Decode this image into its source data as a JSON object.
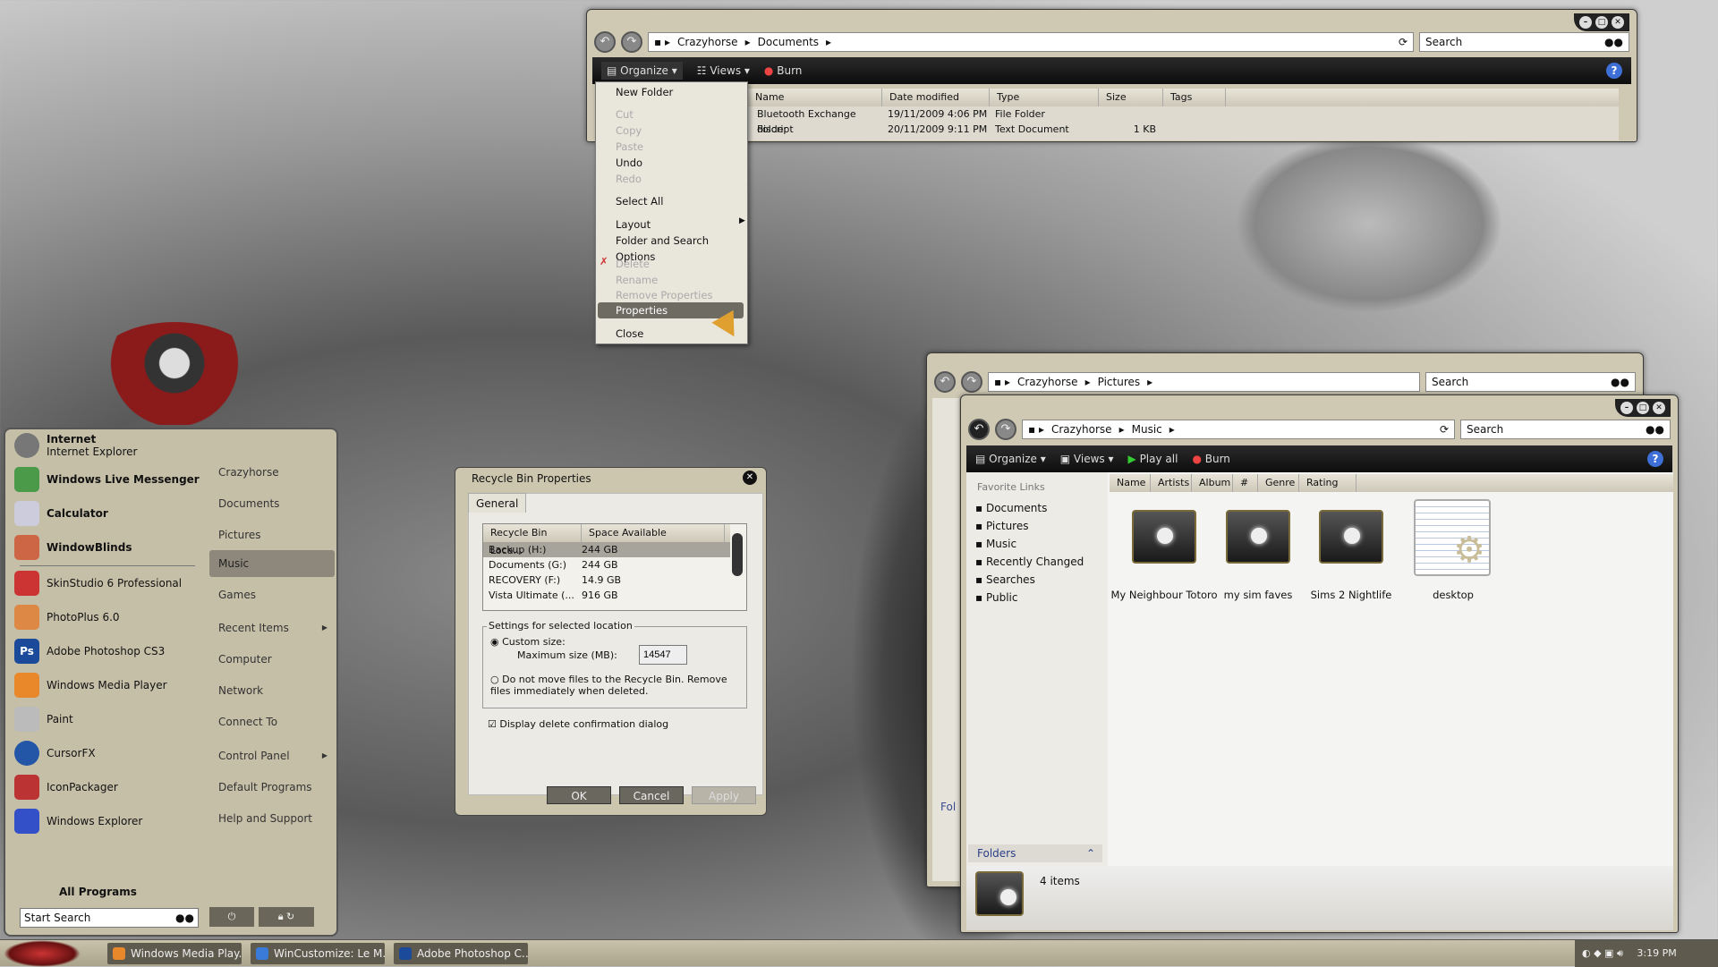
{
  "documents_window": {
    "breadcrumb": [
      "Crazyhorse",
      "Documents"
    ],
    "search_placeholder": "Search",
    "toolbar": {
      "organize": "Organize",
      "views": "Views",
      "burn": "Burn"
    },
    "columns": [
      "Name",
      "Date modified",
      "Type",
      "Size",
      "Tags"
    ],
    "rows": [
      {
        "name": "Bluetooth Exchange Folder",
        "date": "19/11/2009 4:06 PM",
        "type": "File Folder",
        "size": ""
      },
      {
        "name": "discript",
        "date": "20/11/2009 9:11 PM",
        "type": "Text Document",
        "size": "1 KB"
      }
    ]
  },
  "organize_menu": {
    "items": [
      {
        "label": "New Folder",
        "disabled": false
      },
      {
        "label": "Cut",
        "disabled": true
      },
      {
        "label": "Copy",
        "disabled": true
      },
      {
        "label": "Paste",
        "disabled": true
      },
      {
        "label": "Undo",
        "disabled": false
      },
      {
        "label": "Redo",
        "disabled": true
      },
      {
        "label": "Select All",
        "disabled": false
      },
      {
        "label": "Layout",
        "disabled": false
      },
      {
        "label": "Folder and Search Options",
        "disabled": false
      },
      {
        "label": "Delete",
        "disabled": true
      },
      {
        "label": "Rename",
        "disabled": true
      },
      {
        "label": "Remove Properties",
        "disabled": true
      },
      {
        "label": "Properties",
        "disabled": false,
        "selected": true
      },
      {
        "label": "Close",
        "disabled": false
      }
    ]
  },
  "pictures_window": {
    "breadcrumb": [
      "Crazyhorse",
      "Pictures"
    ],
    "search_placeholder": "Search",
    "folders_label": "Fol"
  },
  "music_window": {
    "breadcrumb": [
      "Crazyhorse",
      "Music"
    ],
    "search_placeholder": "Search",
    "toolbar": {
      "organize": "Organize",
      "views": "Views",
      "play_all": "Play all",
      "burn": "Burn"
    },
    "favorite_links_title": "Favorite Links",
    "favorite_links": [
      "Documents",
      "Pictures",
      "Music",
      "Recently Changed",
      "Searches",
      "Public"
    ],
    "columns": [
      "Name",
      "Artists",
      "Album",
      "#",
      "Genre",
      "Rating"
    ],
    "items": [
      "My Neighbour Totoro",
      "my sim faves",
      "Sims 2 Nightlife",
      "desktop"
    ],
    "folders_label": "Folders",
    "status": "4 items"
  },
  "start_menu": {
    "pinned": [
      {
        "title": "Internet",
        "subtitle": "Internet Explorer"
      },
      {
        "title": "Windows Live Messenger"
      },
      {
        "title": "Calculator"
      },
      {
        "title": "WindowBlinds"
      }
    ],
    "recent": [
      "SkinStudio 6 Professional",
      "PhotoPlus 6.0",
      "Adobe Photoshop CS3",
      "Windows Media Player",
      "Paint",
      "CursorFX",
      "IconPackager",
      "Windows Explorer"
    ],
    "right": [
      "Crazyhorse",
      "Documents",
      "Pictures",
      "Music",
      "Games",
      "Recent Items",
      "Computer",
      "Network",
      "Connect To",
      "Control Panel",
      "Default Programs",
      "Help and Support"
    ],
    "all_programs": "All Programs",
    "search_placeholder": "Start Search"
  },
  "recycle_dialog": {
    "title": "Recycle Bin Properties",
    "tab": "General",
    "columns": [
      "Recycle Bin Loca...",
      "Space Available"
    ],
    "rows": [
      {
        "name": "Backup (H:)",
        "space": "244 GB"
      },
      {
        "name": "Documents (G:)",
        "space": "244 GB"
      },
      {
        "name": "RECOVERY (F:)",
        "space": "14.9 GB"
      },
      {
        "name": "Vista Ultimate (...",
        "space": "916 GB"
      }
    ],
    "group_title": "Settings for selected location",
    "custom_size": "Custom size:",
    "max_size_label": "Maximum size (MB):",
    "max_size_value": "14547",
    "no_move": "Do not move files to the Recycle Bin. Remove files immediately when deleted.",
    "confirm": "Display delete confirmation dialog",
    "ok": "OK",
    "cancel": "Cancel",
    "apply": "Apply"
  },
  "taskbar": {
    "buttons": [
      "Windows Media Play...",
      "WinCustomize: Le M...",
      "Adobe Photoshop C..."
    ],
    "clock": "3:19 PM"
  }
}
